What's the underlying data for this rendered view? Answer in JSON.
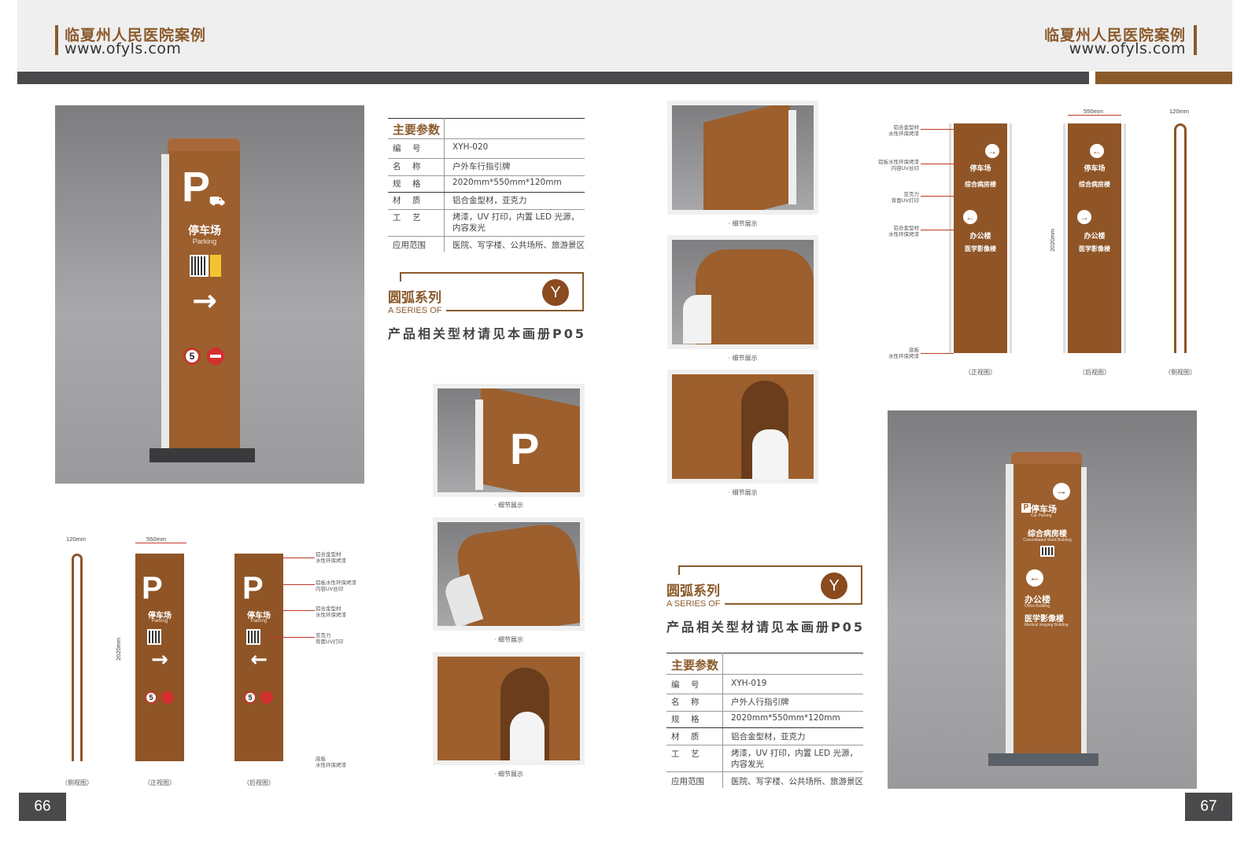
{
  "header": {
    "left_title": "临夏州人民医院案例",
    "left_url": "www.ofyls.com",
    "right_title": "临夏州人民医院案例",
    "right_url": "www.ofyls.com"
  },
  "left_page": {
    "page_number": "66",
    "sign": {
      "title_cn": "停车场",
      "title_en": "Parking",
      "letter": "P",
      "arrow": "→",
      "speed": "5"
    },
    "specs": {
      "heading": "主要参数",
      "rows": [
        {
          "key": "编　号",
          "value": "XYH-020"
        },
        {
          "key": "名　称",
          "value": "户外车行指引牌"
        },
        {
          "key": "规　格",
          "value": "2020mm*550mm*120mm"
        },
        {
          "key": "材　质",
          "value": "铝合金型材，亚克力"
        },
        {
          "key": "工　艺",
          "value": "烤漆，UV 打印，内置 LED 光源，内容发光"
        },
        {
          "key": "应用范围",
          "value": "医院、写字楼、公共场所、旅游景区"
        }
      ]
    },
    "series": {
      "cn": "圆弧系列",
      "en": "A SERIES OF",
      "badge": "Y",
      "note": "产品相关型材请见本画册P05"
    },
    "thumb_caption": "· 细节展示",
    "drawing": {
      "dim_depth": "120mm",
      "dim_width": "550mm",
      "dim_height": "2020mm",
      "view_side": "（侧视图）",
      "view_front": "（正视图）",
      "view_back": "（后视图）",
      "notes": [
        "铝合金型材\n水性环保烤漆",
        "铝板水性环保烤漆\n内容UV丝印",
        "铝合金型材\n水性环保烤漆",
        "亚克力\n背面UV打印",
        "底板\n水性环保烤漆"
      ]
    }
  },
  "right_page": {
    "page_number": "67",
    "sign": {
      "line1": "停车场",
      "line1_en": "Car Parking",
      "line2": "综合病房楼",
      "line2_en": "Consolidated Ward Building",
      "line3": "办公楼",
      "line3_en": "Office Building",
      "line4": "医学影像楼",
      "line4_en": "Medical Imaging Building",
      "letter": "P",
      "arrow_right": "→",
      "arrow_left": "←"
    },
    "specs": {
      "heading": "主要参数",
      "rows": [
        {
          "key": "编　号",
          "value": "XYH-019"
        },
        {
          "key": "名　称",
          "value": "户外人行指引牌"
        },
        {
          "key": "规　格",
          "value": "2020mm*550mm*120mm"
        },
        {
          "key": "材　质",
          "value": "铝合金型材，亚克力"
        },
        {
          "key": "工　艺",
          "value": "烤漆，UV 打印，内置 LED 光源，内容发光"
        },
        {
          "key": "应用范围",
          "value": "医院、写字楼、公共场所、旅游景区"
        }
      ]
    },
    "series": {
      "cn": "圆弧系列",
      "en": "A SERIES OF",
      "badge": "Y",
      "note": "产品相关型材请见本画册P05"
    },
    "thumb_caption": "· 细节展示",
    "drawing": {
      "dim_width": "550mm",
      "dim_depth": "120mm",
      "dim_height": "2020mm",
      "view_front": "（正视图）",
      "view_back": "（后视图）",
      "view_side": "（侧视图）",
      "notes": [
        "铝合金型材\n水性环保烤漆",
        "铝板水性环保烤漆\n内容UV丝印",
        "亚克力\n背面UV打印",
        "铝合金型材\n水性环保烤漆",
        "底板\n水性环保烤漆"
      ]
    }
  },
  "colors": {
    "brand_brown": "#8b5a2b",
    "sign_brown": "#9c5f2d",
    "dark_gray": "#4a4a4c"
  }
}
